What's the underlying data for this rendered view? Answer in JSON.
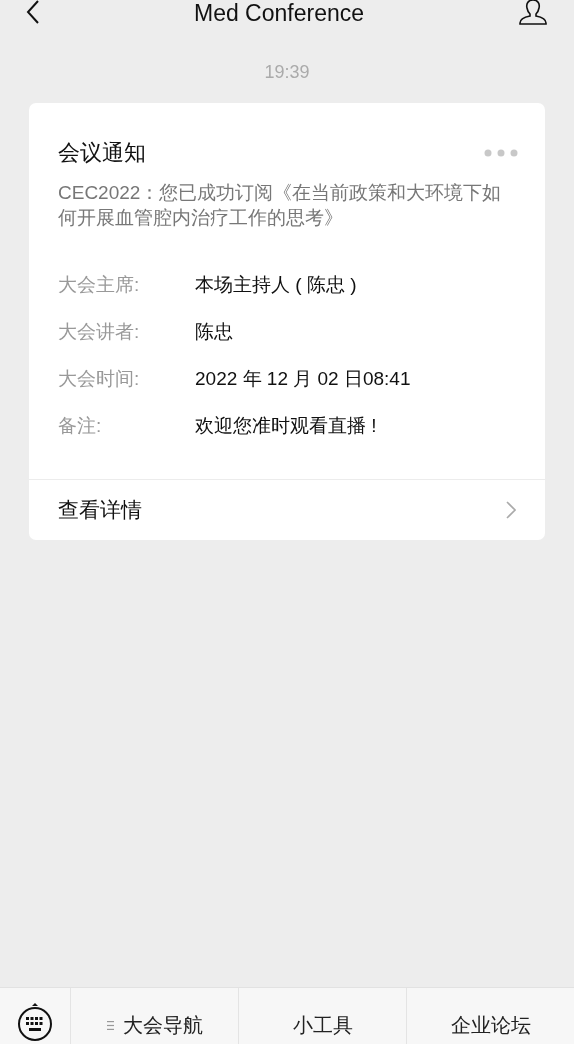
{
  "header": {
    "title": "Med Conference"
  },
  "timestamp": "19:39",
  "card": {
    "title": "会议通知",
    "summary": "CEC2022：您已成功订阅《在当前政策和大环境下如何开展血管腔内治疗工作的思考》",
    "fields": [
      {
        "label": "大会主席:",
        "value": "本场主持人 ( 陈忠 )"
      },
      {
        "label": "大会讲者:",
        "value": "陈忠"
      },
      {
        "label": "大会时间:",
        "value": "2022 年 12 月 02 日08:41"
      },
      {
        "label": "备注:",
        "value": "欢迎您准时观看直播 !"
      }
    ],
    "link": "查看详情"
  },
  "bottom_menu": [
    {
      "label": "大会导航",
      "has_submenu": true
    },
    {
      "label": "小工具",
      "has_submenu": false
    },
    {
      "label": "企业论坛",
      "has_submenu": false
    }
  ]
}
